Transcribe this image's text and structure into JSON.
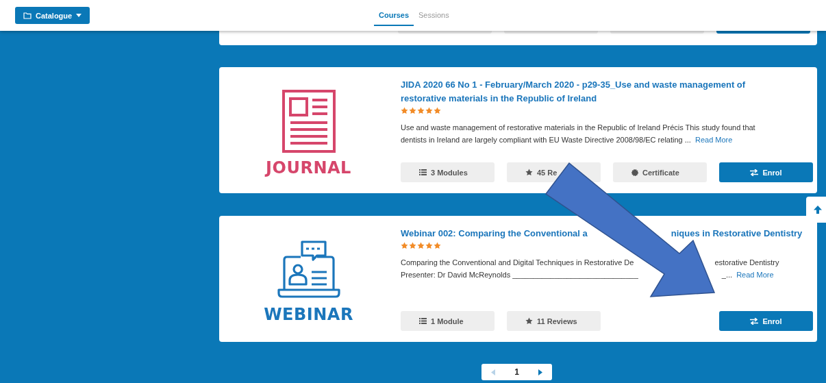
{
  "header": {
    "catalogue_button": "Catalogue",
    "tabs": [
      {
        "label": "Courses",
        "selected": true
      },
      {
        "label": "Sessions",
        "selected": false
      }
    ]
  },
  "cards": [
    {
      "kind": "journal",
      "label": "JOURNAL",
      "title": [
        "JIDA 2020 66 No 1 - February/March 2020 - p29-35_Use and waste management of restorative materials in the Republic of Ireland"
      ],
      "stars": 5,
      "description": [
        [
          "Use and waste management of restorative materials in the Republic of Ireland   Précis This study found that"
        ],
        [
          "dentists in Ireland are largely compliant with EU Waste Directive 2008/98/EC relating ..."
        ]
      ],
      "read_more": "Read More",
      "buttons": [
        {
          "kind": "modules",
          "label": "3 Modules"
        },
        {
          "kind": "reviews",
          "label": "45 Re"
        },
        {
          "kind": "certificate",
          "label": "Certificate"
        },
        {
          "kind": "enrol",
          "label": "Enrol"
        }
      ]
    },
    {
      "kind": "webinar",
      "label": "WEBINAR",
      "title": [
        "Webinar 002: Comparing the Conventional a",
        "niques in Restorative Dentistry"
      ],
      "stars": 5,
      "description": [
        [
          "Comparing the Conventional and Digital Techniques in Restorative De",
          "estorative Dentistry"
        ],
        [
          "Presenter: Dr David McReynolds ______________________________",
          "_..."
        ]
      ],
      "read_more": "Read More",
      "buttons": [
        {
          "kind": "modules",
          "label": "1 Module"
        },
        {
          "kind": "reviews",
          "label": "11 Reviews"
        },
        {
          "kind": "enrol",
          "label": "Enrol"
        }
      ]
    }
  ],
  "pagination": {
    "current": "1"
  }
}
